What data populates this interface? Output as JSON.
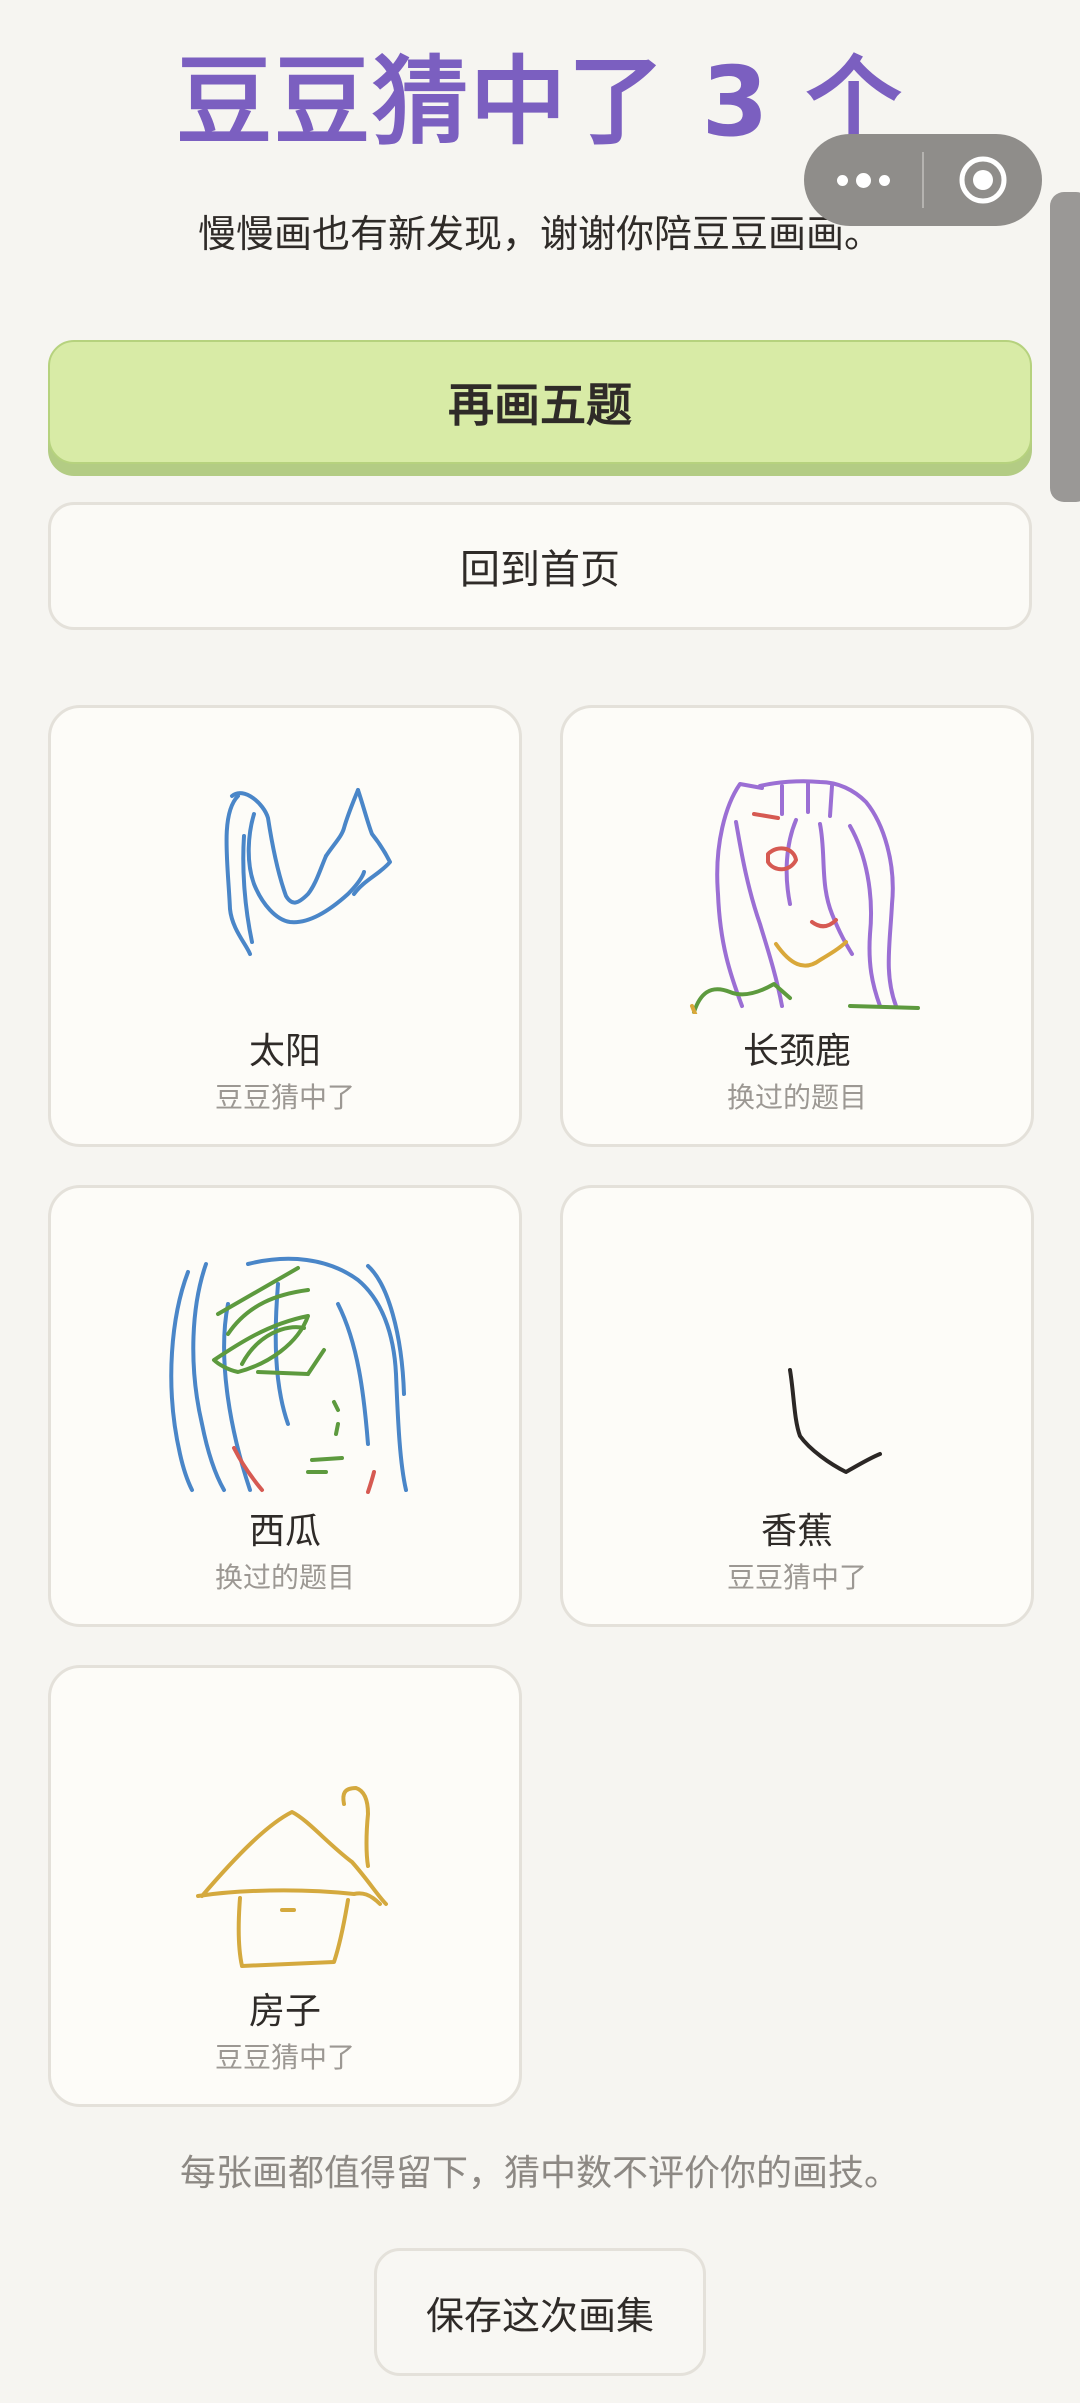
{
  "header": {
    "title": "豆豆猜中了 3 个",
    "subtitle": "慢慢画也有新发现，谢谢你陪豆豆画画。"
  },
  "capsule": {
    "more_icon": "more-dots-icon",
    "close_icon": "target-circle-icon"
  },
  "actions": {
    "primary_label": "再画五题",
    "secondary_label": "回到首页"
  },
  "cards": [
    {
      "name": "太阳",
      "status": "豆豆猜中了"
    },
    {
      "name": "长颈鹿",
      "status": "换过的题目"
    },
    {
      "name": "西瓜",
      "status": "换过的题目"
    },
    {
      "name": "香蕉",
      "status": "豆豆猜中了"
    },
    {
      "name": "房子",
      "status": "豆豆猜中了"
    }
  ],
  "footer": {
    "note": "每张画都值得留下，猜中数不评价你的画技。",
    "save_label": "保存这次画集"
  },
  "colors": {
    "title": "#7b5fc0",
    "primary_button": "#d8eba6",
    "background": "#f6f5f1"
  }
}
